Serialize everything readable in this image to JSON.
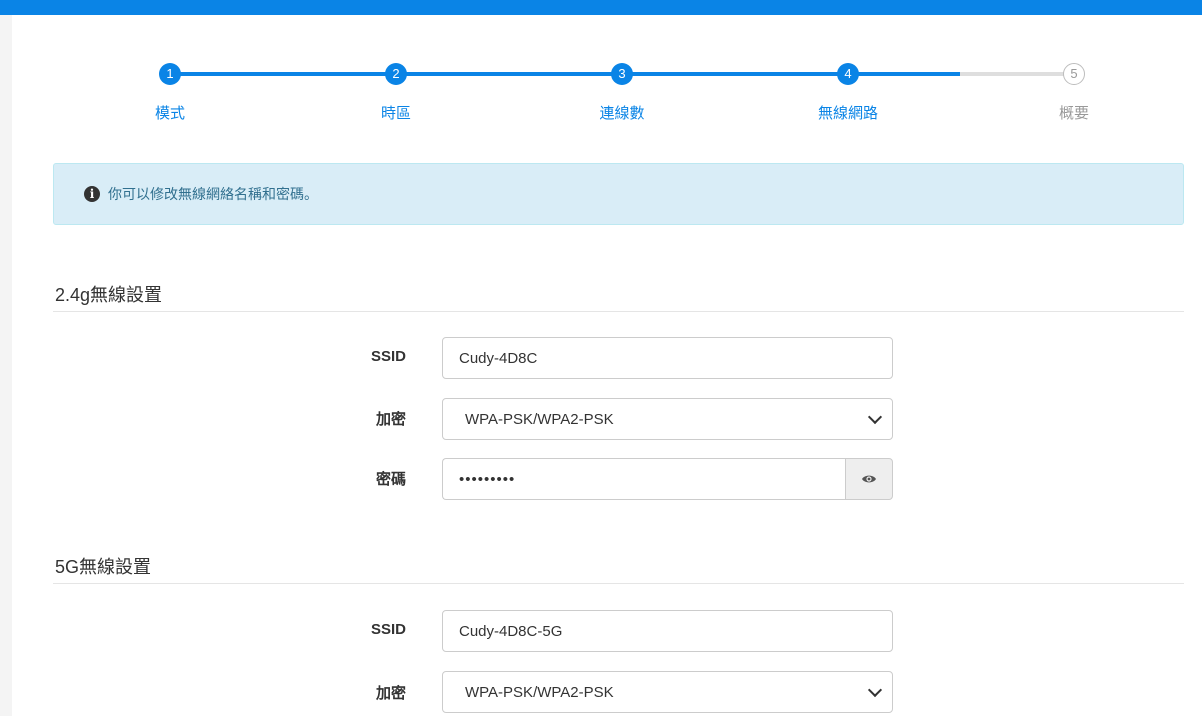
{
  "stepper": {
    "steps": [
      {
        "number": "1",
        "label": "模式",
        "state": "done"
      },
      {
        "number": "2",
        "label": "時區",
        "state": "done"
      },
      {
        "number": "3",
        "label": "連線數",
        "state": "done"
      },
      {
        "number": "4",
        "label": "無線網路",
        "state": "current"
      },
      {
        "number": "5",
        "label": "概要",
        "state": "todo"
      }
    ],
    "current_step": 4
  },
  "alert": {
    "icon": "info-circle-icon",
    "text": "你可以修改無線網絡名稱和密碼。"
  },
  "wifi24": {
    "title": "2.4g無線設置",
    "ssid_label": "SSID",
    "ssid_value": "Cudy-4D8C",
    "encryption_label": "加密",
    "encryption_value": "WPA-PSK/WPA2-PSK",
    "password_label": "密碼",
    "password_masked": "•••••••••",
    "toggle_icon": "eye-icon"
  },
  "wifi5": {
    "title": "5G無線設置",
    "ssid_label": "SSID",
    "ssid_value": "Cudy-4D8C-5G",
    "encryption_label": "加密",
    "encryption_value": "WPA-PSK/WPA2-PSK"
  },
  "colors": {
    "accent": "#0a84e6",
    "alert_bg": "#d9edf7",
    "alert_text": "#31708f"
  }
}
